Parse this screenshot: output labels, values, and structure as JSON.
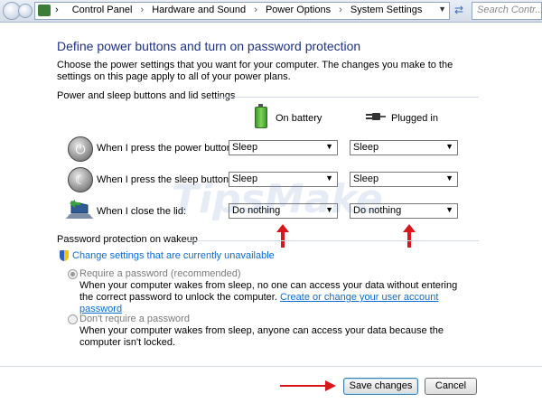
{
  "address_bar": {
    "crumbs": [
      "Control Panel",
      "Hardware and Sound",
      "Power Options",
      "System Settings"
    ],
    "search_placeholder": "Search Contr..."
  },
  "page": {
    "title": "Define power buttons and turn on password protection",
    "description": "Choose the power settings that you want for your computer. The changes you make to the settings on this page apply to all of your power plans."
  },
  "power_section": {
    "title": "Power and sleep buttons and lid settings",
    "col_battery": "On battery",
    "col_plugged": "Plugged in",
    "rows": [
      {
        "label": "When I press the power button:",
        "battery": "Sleep",
        "plugged": "Sleep"
      },
      {
        "label": "When I press the sleep button:",
        "battery": "Sleep",
        "plugged": "Sleep"
      },
      {
        "label": "When I close the lid:",
        "battery": "Do nothing",
        "plugged": "Do nothing"
      }
    ]
  },
  "password_section": {
    "title": "Password protection on wakeup",
    "change_link": "Change settings that are currently unavailable",
    "require_label": "Require a password (recommended)",
    "require_desc": "When your computer wakes from sleep, no one can access your data without entering the correct password to unlock the computer.",
    "require_link": "Create or change your user account password",
    "dont_label": "Don't require a password",
    "dont_desc": "When your computer wakes from sleep, anyone can access your data because the computer isn't locked."
  },
  "buttons": {
    "save": "Save changes",
    "cancel": "Cancel"
  },
  "watermark": "TipsMake",
  "colors": {
    "title_blue": "#1e3287",
    "link_blue": "#0a6cd6",
    "annotation_red": "#d9161b"
  }
}
